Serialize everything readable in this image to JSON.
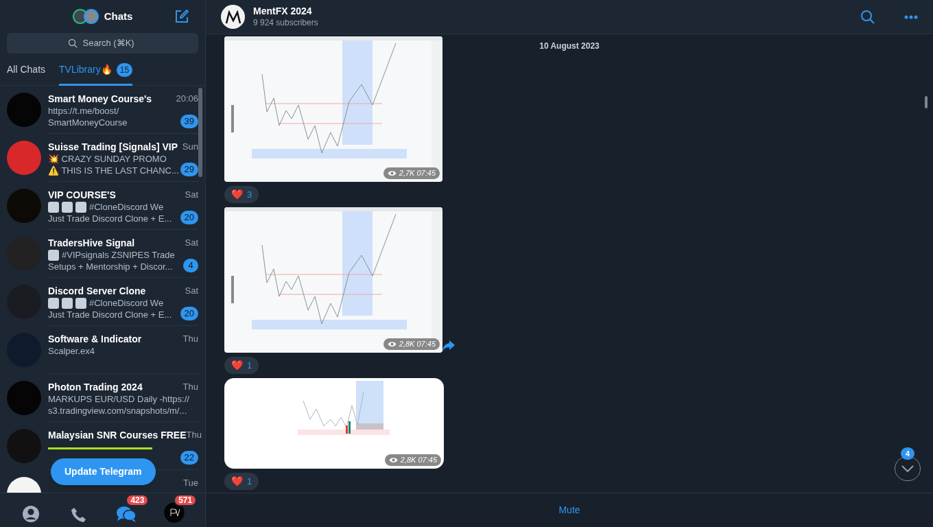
{
  "sidebar": {
    "title": "Chats",
    "search": {
      "placeholder": "Search (⌘K)"
    },
    "folders": [
      {
        "label": "All Chats",
        "selected": false
      },
      {
        "label": "TVLibrary🔥",
        "selected": true,
        "badge": "15"
      }
    ],
    "chats": [
      {
        "name": "Smart Money Course's",
        "time": "20:06",
        "preview": [
          [
            {
              "kind": "text",
              "text": "https://t.me/boost/"
            }
          ],
          [
            {
              "kind": "text",
              "text": "SmartMoneyCourse"
            }
          ]
        ],
        "unread": "39"
      },
      {
        "name": "Suisse Trading [Signals] VIP",
        "time": "Sun",
        "preview": [
          [
            {
              "kind": "text",
              "text": "💥 CRAZY SUNDAY PROMO"
            }
          ],
          [
            {
              "kind": "text",
              "text": "⚠️ THIS IS THE LAST CHANC..."
            }
          ]
        ],
        "unread": "29"
      },
      {
        "name": "VIP COURSE'S",
        "time": "Sat",
        "preview": [
          [
            {
              "kind": "thumb"
            },
            {
              "kind": "thumb"
            },
            {
              "kind": "thumb"
            },
            {
              "kind": "text",
              "text": "#CloneDiscord  We"
            }
          ],
          [
            {
              "kind": "text",
              "text": "Just Trade Discord Clone + E..."
            }
          ]
        ],
        "unread": "20"
      },
      {
        "name": "TradersHive Signal",
        "time": "Sat",
        "preview": [
          [
            {
              "kind": "thumb"
            },
            {
              "kind": "text",
              "text": "#VIPsignals  ZSNIPES Trade"
            }
          ],
          [
            {
              "kind": "text",
              "text": "Setups + Mentorship + Discor..."
            }
          ]
        ],
        "unread": "4"
      },
      {
        "name": "Discord Server Clone",
        "time": "Sat",
        "preview": [
          [
            {
              "kind": "thumb"
            },
            {
              "kind": "thumb"
            },
            {
              "kind": "thumb"
            },
            {
              "kind": "text",
              "text": "#CloneDiscord  We"
            }
          ],
          [
            {
              "kind": "text",
              "text": "Just Trade Discord Clone + E..."
            }
          ]
        ],
        "unread": "20"
      },
      {
        "name": "Software & Indicator",
        "time": "Thu",
        "preview": [
          [
            {
              "kind": "text",
              "text": "Scalper.ex4"
            }
          ]
        ]
      },
      {
        "name": "Photon Trading 2024",
        "time": "Thu",
        "preview": [
          [
            {
              "kind": "text",
              "text": "MARKUPS  EUR/USD  Daily -https://"
            }
          ],
          [
            {
              "kind": "text",
              "text": "s3.tradingview.com/snapshots/m/..."
            }
          ]
        ]
      },
      {
        "name": "Malaysian SNR Courses FREE",
        "time": "Thu",
        "preview": [
          [
            {
              "kind": "rule"
            }
          ]
        ],
        "unread": "22"
      },
      {
        "time": "Tue"
      }
    ],
    "update_button": "Update Telegram",
    "nav": [
      {
        "kind": "profile",
        "selected": false
      },
      {
        "kind": "calls",
        "selected": false
      },
      {
        "kind": "chats",
        "selected": true,
        "badge": "423"
      },
      {
        "kind": "settings",
        "selected": false,
        "badge": "571"
      }
    ]
  },
  "channel": {
    "title": "MentFX 2024",
    "subtitle": "9 924 subscribers"
  },
  "date": "10 August 2023",
  "messages": [
    {
      "kind": "wide",
      "views": "2,7K",
      "time": "07:45",
      "share": false,
      "reaction": {
        "emoji": "❤️",
        "count": "3"
      }
    },
    {
      "kind": "wide",
      "views": "2,8K",
      "time": "07:45",
      "share": true,
      "reaction": {
        "emoji": "❤️",
        "count": "1"
      }
    },
    {
      "kind": "short",
      "views": "2,8K",
      "time": "07:45",
      "share": false,
      "reaction": {
        "emoji": "❤️",
        "count": "1"
      }
    }
  ],
  "scroll_down": {
    "badge": "4"
  },
  "footer": {
    "button": "Mute"
  }
}
